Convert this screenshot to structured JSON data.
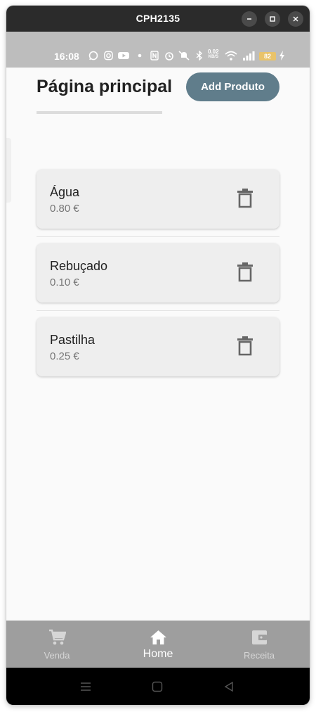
{
  "window": {
    "title": "CPH2135"
  },
  "status_bar": {
    "time": "16:08",
    "speed_value": "0.02",
    "speed_unit": "KB/S",
    "battery": "82",
    "icons": [
      "whatsapp-icon",
      "instagram-icon",
      "youtube-icon",
      "dot-icon",
      "nfc-icon",
      "alarm-icon",
      "mute-icon",
      "bluetooth-icon",
      "wifi-icon",
      "signal-icon",
      "charging-icon"
    ]
  },
  "header": {
    "title": "Página principal",
    "add_button_label": "Add Produto"
  },
  "products": [
    {
      "name": "Água",
      "price": "0.80 €"
    },
    {
      "name": "Rebuçado",
      "price": "0.10 €"
    },
    {
      "name": "Pastilha",
      "price": "0.25 €"
    }
  ],
  "bottom_nav": {
    "items": [
      {
        "label": "Venda",
        "icon": "cart-icon",
        "active": false
      },
      {
        "label": "Home",
        "icon": "home-icon",
        "active": true
      },
      {
        "label": "Receita",
        "icon": "wallet-icon",
        "active": false
      }
    ]
  },
  "colors": {
    "accent": "#607d8b",
    "card": "#eeeeee",
    "nav": "#9e9e9e",
    "status_bar": "#bdbdbd"
  }
}
